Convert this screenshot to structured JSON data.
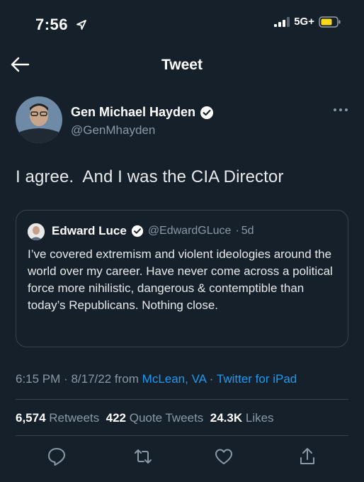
{
  "status_bar": {
    "time": "7:56",
    "network": "5G+"
  },
  "header": {
    "title": "Tweet"
  },
  "tweet": {
    "author_name": "Gen Michael Hayden",
    "author_handle": "@GenMhayden",
    "text": "I agree.  And I was the CIA Director",
    "quoted": {
      "author_name": "Edward Luce",
      "author_handle": "@EdwardGLuce",
      "separator": "·",
      "age": "5d",
      "text": "I’ve covered extremism and violent ideologies around the world over my career. Have never come across a political force more nihilistic, dangerous & contemptible than today’s Republicans. Nothing close."
    },
    "meta": {
      "time": "6:15 PM",
      "sep1": "·",
      "date": "8/17/22",
      "from_label": "from",
      "location": "McLean, VA",
      "sep2": "·",
      "source": "Twitter for iPad"
    },
    "stats": {
      "retweets_count": "6,574",
      "retweets_label": "Retweets",
      "quote_count": "422",
      "quote_label": "Quote Tweets",
      "likes_count": "24.3K",
      "likes_label": "Likes"
    }
  },
  "colors": {
    "background": "#15202b",
    "accent": "#1d9bf0",
    "secondary_text": "#8b98a5",
    "border": "#38444d",
    "battery": "#f9d71c"
  },
  "icons": [
    "location-arrow-icon",
    "signal-icon",
    "battery-icon",
    "back-arrow-icon",
    "verified-badge-icon",
    "more-icon",
    "reply-icon",
    "retweet-icon",
    "like-icon",
    "share-icon"
  ]
}
